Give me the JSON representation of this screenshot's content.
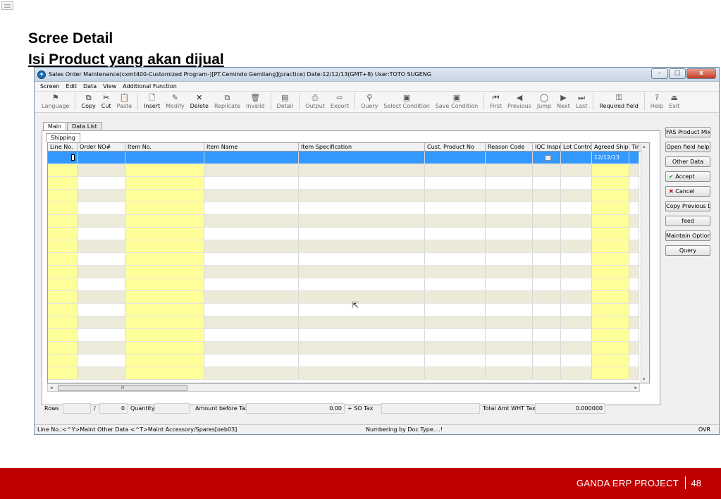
{
  "slide": {
    "title": "Scree Detail",
    "subtitle": "Isi Product yang akan dijual",
    "footer_text": "GANDA ERP PROJECT",
    "page_number": "48"
  },
  "window": {
    "title": "Sales Order Maintenance(cxmt400-Customized Program-)[PT.Cemindo Gemilang](practice)  Date:12/12/13(GMT+8)  User:TOTO SUGENG",
    "minimize": "–",
    "maximize": "□",
    "close": "x"
  },
  "menu": [
    "Screen",
    "Edit",
    "Data",
    "View",
    "Additional Function"
  ],
  "toolbar": [
    {
      "label": "Language",
      "icon": "flag-icon",
      "glyph": "⚑",
      "enabled": false
    },
    {
      "label": "Copy",
      "icon": "copy-icon",
      "glyph": "⧉",
      "enabled": true
    },
    {
      "label": "Cut",
      "icon": "scissors-icon",
      "glyph": "✂",
      "enabled": true
    },
    {
      "label": "Paste",
      "icon": "paste-icon",
      "glyph": "📋",
      "enabled": false
    },
    {
      "label": "Insert",
      "icon": "new-page-icon",
      "glyph": "🗋",
      "enabled": true
    },
    {
      "label": "Modify",
      "icon": "pencil-icon",
      "glyph": "✎",
      "enabled": false
    },
    {
      "label": "Delete",
      "icon": "delete-icon",
      "glyph": "✕",
      "enabled": true
    },
    {
      "label": "Replicate",
      "icon": "replicate-icon",
      "glyph": "⧉",
      "enabled": false
    },
    {
      "label": "Invalid",
      "icon": "trash-icon",
      "glyph": "🗑",
      "enabled": false
    },
    {
      "label": "Detail",
      "icon": "detail-icon",
      "glyph": "▤",
      "enabled": false
    },
    {
      "label": "Output",
      "icon": "printer-icon",
      "glyph": "⎙",
      "enabled": false
    },
    {
      "label": "Export",
      "icon": "export-icon",
      "glyph": "⇨",
      "enabled": false
    },
    {
      "label": "Query",
      "icon": "binoculars-icon",
      "glyph": "⚲",
      "enabled": false
    },
    {
      "label": "Select Condition",
      "icon": "select-condition-icon",
      "glyph": "▣",
      "enabled": false
    },
    {
      "label": "Save Condition",
      "icon": "save-condition-icon",
      "glyph": "▣",
      "enabled": false
    },
    {
      "label": "First",
      "icon": "first-icon",
      "glyph": "⏮",
      "enabled": false
    },
    {
      "label": "Previous",
      "icon": "previous-icon",
      "glyph": "◀",
      "enabled": false
    },
    {
      "label": "Jump",
      "icon": "jump-icon",
      "glyph": "◯",
      "enabled": false
    },
    {
      "label": "Next",
      "icon": "next-icon",
      "glyph": "▶",
      "enabled": false
    },
    {
      "label": "Last",
      "icon": "last-icon",
      "glyph": "⏭",
      "enabled": false
    },
    {
      "label": "Required field",
      "icon": "key-icon",
      "glyph": "⚿",
      "enabled": true
    },
    {
      "label": "Help",
      "icon": "help-icon",
      "glyph": "?",
      "enabled": false
    },
    {
      "label": "Exit",
      "icon": "exit-icon",
      "glyph": "⏏",
      "enabled": false
    }
  ],
  "tabs": [
    {
      "label": "Main",
      "active": true
    },
    {
      "label": "Data List",
      "active": false
    }
  ],
  "subtab": "Shipping",
  "grid": {
    "columns": [
      {
        "label": "Line No.",
        "yellow": true
      },
      {
        "label": "Order NO#",
        "yellow": false
      },
      {
        "label": "Item No.",
        "yellow": true
      },
      {
        "label": "Item Name",
        "yellow": false
      },
      {
        "label": "Item Specification",
        "yellow": false
      },
      {
        "label": "Cust. Product No",
        "yellow": false
      },
      {
        "label": "Reason Code",
        "yellow": false
      },
      {
        "label": "IQC Inspe",
        "yellow": false
      },
      {
        "label": "Lot Control",
        "yellow": false
      },
      {
        "label": "Agreed Shippi",
        "yellow": true
      },
      {
        "label": "Tin",
        "yellow": false
      }
    ],
    "selected_row_date": "12/12/13",
    "row_count": 18
  },
  "side_buttons": [
    "FAS Product Mix",
    "Open field help",
    "Other Data",
    "Accept",
    "Cancel",
    "Copy Previous D",
    "feed",
    "Maintain Option",
    "Query"
  ],
  "totals": {
    "rows_label": "Rows",
    "rows_sep": "/",
    "rows_total": "0",
    "quantity_label": "Quantity",
    "amount_label": "Amount before Tax",
    "amount_value": "0.00",
    "tax_label": "+ SO Tax",
    "wht_label": "Total Amt WHT Tax",
    "wht_value": "0.000000"
  },
  "status": {
    "left": "Line No.:<^Y>Maint Other Data <^T>Maint Accessory/Spares[oeb03]",
    "center": "Numbering by Doc Type....!",
    "right": "OVR"
  },
  "scroll": {
    "thumb_text": "III",
    "left_arrow": "◂",
    "right_arrow": "▸",
    "up_arrow": "▴",
    "down_arrow": "▾"
  },
  "colors": {
    "footer": "#c00000",
    "selection": "#3399ff",
    "required": "#ffff99"
  }
}
